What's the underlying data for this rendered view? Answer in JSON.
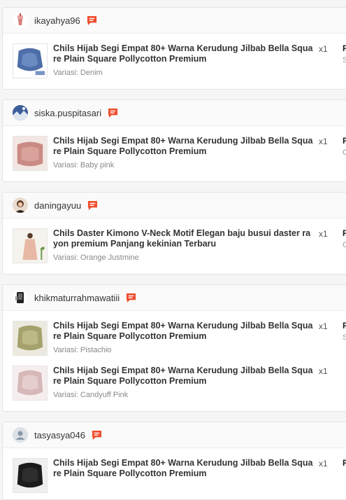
{
  "icons": {
    "chat": "chat-bubble-icon"
  },
  "colors": {
    "chat_accent": "#ee4d2d"
  },
  "orders": [
    {
      "username": "ikayahya96",
      "avatar_icon": "avatar-drink-icon",
      "items": [
        {
          "title": "Chils Hijab Segi Empat 80+ Warna Kerudung Jilbab Bella Square Plain Square Pollycotton Premium",
          "variant": "Variasi: Denim",
          "qty": "x1",
          "price": "R",
          "status": "S"
        }
      ]
    },
    {
      "username": "siska.puspitasari",
      "avatar_icon": "avatar-landscape-icon",
      "items": [
        {
          "title": "Chils Hijab Segi Empat 80+ Warna Kerudung Jilbab Bella Square Plain Square Pollycotton Premium",
          "variant": "Variasi: Baby pink",
          "qty": "x1",
          "price": "R",
          "status": "C"
        }
      ]
    },
    {
      "username": "daningayuu",
      "avatar_icon": "avatar-person-icon",
      "items": [
        {
          "title": "Chils Daster Kimono V-Neck Motif Elegan baju busui daster rayon premium Panjang kekinian Terbaru",
          "variant": "Variasi: Orange Justmine",
          "qty": "x1",
          "price": "R",
          "status": "C"
        }
      ]
    },
    {
      "username": "khikmaturrahmawatiii",
      "avatar_icon": "avatar-phone-icon",
      "items": [
        {
          "title": "Chils Hijab Segi Empat 80+ Warna Kerudung Jilbab Bella Square Plain Square Pollycotton Premium",
          "variant": "Variasi: Pistachio",
          "qty": "x1",
          "price": "R",
          "status": "S"
        },
        {
          "title": "Chils Hijab Segi Empat 80+ Warna Kerudung Jilbab Bella Square Plain Square Pollycotton Premium",
          "variant": "Variasi: Candyuff Pink",
          "qty": "x1",
          "price": "",
          "status": ""
        }
      ]
    },
    {
      "username": "tasyasya046",
      "avatar_icon": "avatar-default-icon",
      "items": [
        {
          "title": "Chils Hijab Segi Empat 80+ Warna Kerudung Jilbab Bella Square Plain Square Pollycotton Premium",
          "variant": "",
          "qty": "x1",
          "price": "R",
          "status": ""
        }
      ]
    }
  ]
}
